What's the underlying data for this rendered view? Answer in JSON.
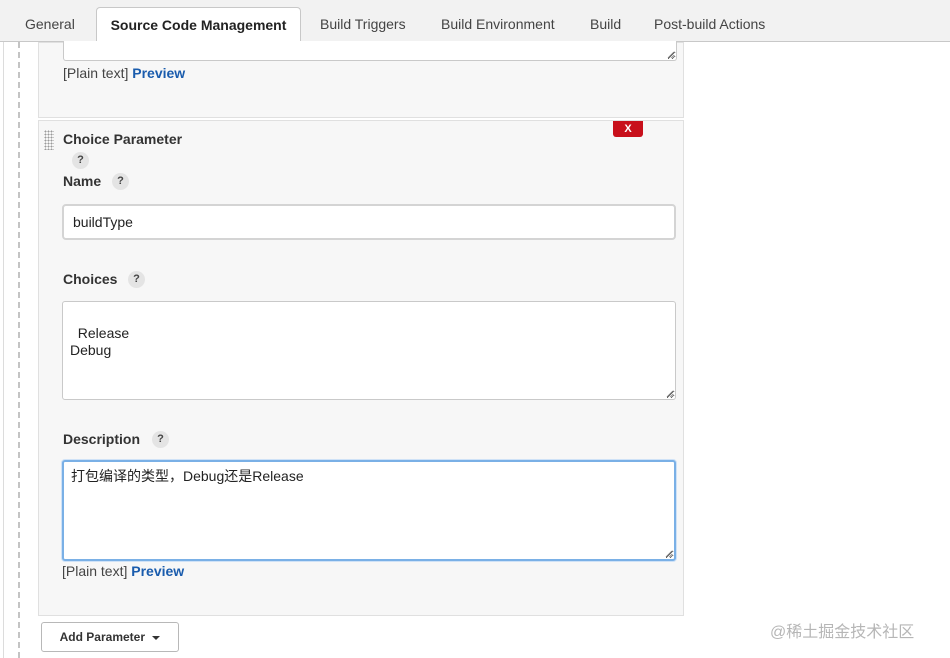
{
  "tabs": [
    {
      "label": "General"
    },
    {
      "label": "Source Code Management"
    },
    {
      "label": "Build Triggers"
    },
    {
      "label": "Build Environment"
    },
    {
      "label": "Build"
    },
    {
      "label": "Post-build Actions"
    }
  ],
  "prev_param": {
    "plain_text": "[Plain text]",
    "preview": "Preview"
  },
  "choice_param": {
    "title": "Choice Parameter",
    "help": "?",
    "delete_label": "X",
    "name_label": "Name",
    "name_value": "buildType",
    "choices_label": "Choices",
    "choices_value": "Release\nDebug",
    "description_label": "Description",
    "description_value": "打包编译的类型，Debug还是Release",
    "plain_text": "[Plain text]",
    "preview": "Preview"
  },
  "add_parameter_label": "Add Parameter",
  "watermark": "@稀土掘金技术社区",
  "colors": {
    "delete": "#c8101b",
    "link": "#1a5cad",
    "focus": "#7ab0e6"
  }
}
